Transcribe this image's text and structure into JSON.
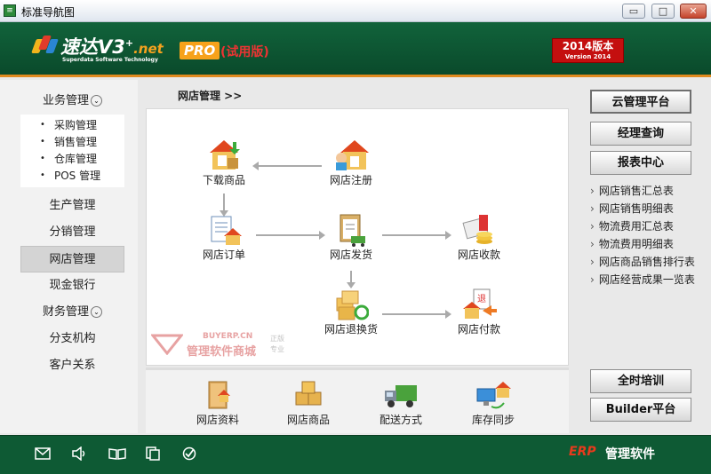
{
  "window": {
    "title": "标准导航图",
    "min_label": "▭",
    "max_label": "□",
    "close_label": "✕"
  },
  "header": {
    "logo_main": "速达V3",
    "logo_plus": "+",
    "logo_net": ".net",
    "logo_sub": "Superdata Software Technology",
    "pro": "PRO",
    "trial": "(试用版)",
    "version_cn": "2014版本",
    "version_en": "Version 2014"
  },
  "leftnav": {
    "items": [
      {
        "label": "业务管理",
        "expand": "⌄"
      },
      {
        "label": "生产管理"
      },
      {
        "label": "分销管理"
      },
      {
        "label": "网店管理"
      },
      {
        "label": "现金银行"
      },
      {
        "label": "财务管理",
        "expand": "⌄"
      },
      {
        "label": "分支机构"
      },
      {
        "label": "客户关系"
      }
    ],
    "sub_items": [
      "采购管理",
      "销售管理",
      "仓库管理",
      "POS 管理"
    ]
  },
  "breadcrumb": "网店管理  >>",
  "flow": {
    "download": "下载商品",
    "register": "网店注册",
    "order": "网店订单",
    "ship": "网店发货",
    "receive": "网店收款",
    "return": "网店退换货",
    "pay": "网店付款"
  },
  "watermark": {
    "text": "BUYERP.CN",
    "cn": "管理软件商城",
    "side1": "正版",
    "side2": "专业"
  },
  "bottom_tools": [
    "网店资料",
    "网店商品",
    "配送方式",
    "库存同步"
  ],
  "right": {
    "top_buttons": [
      "云管理平台",
      "经理查询",
      "报表中心"
    ],
    "links": [
      "网店销售汇总表",
      "网店销售明细表",
      "物流费用汇总表",
      "物流费用明细表",
      "网店商品销售排行表",
      "网店经营成果一览表"
    ],
    "bottom_buttons": [
      "全时培训",
      "Builder平台"
    ]
  },
  "footer": {
    "erp": "ERP",
    "text": "管理软件"
  },
  "colors": {
    "brand_green": "#0e5a34",
    "accent_orange": "#e08a1f",
    "version_red": "#c40f0f"
  }
}
